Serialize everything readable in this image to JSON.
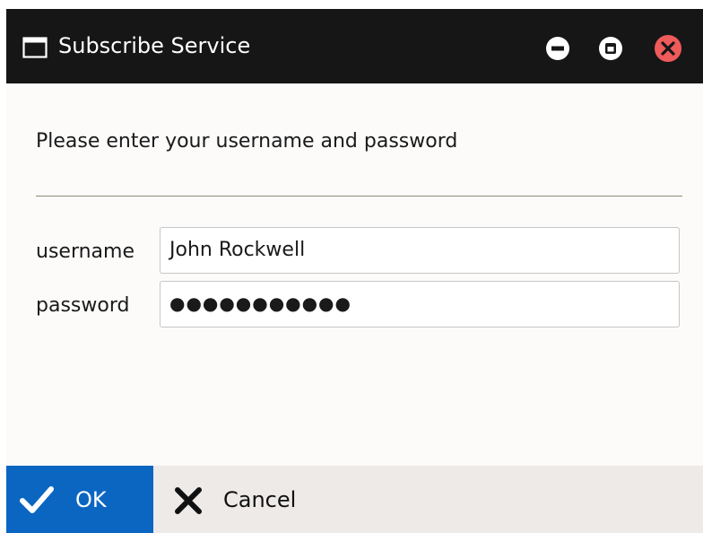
{
  "window": {
    "title": "Subscribe Service",
    "icon": "window-icon",
    "controls": [
      "minimize-icon",
      "maximize-icon",
      "close-icon"
    ]
  },
  "form": {
    "prompt": "Please enter your username and password",
    "username_label": "username",
    "username_value": "John Rockwell",
    "password_label": "password",
    "password_value": "●●●●●●●●●●●"
  },
  "footer": {
    "ok_label": "OK",
    "ok_icon": "checkmark-icon",
    "cancel_label": "Cancel",
    "cancel_icon": "x-icon"
  },
  "colors": {
    "titlebar": "#161616",
    "ok_button": "#0b66c2",
    "close_button": "#ef5a5a",
    "footer": "#edeae8"
  }
}
